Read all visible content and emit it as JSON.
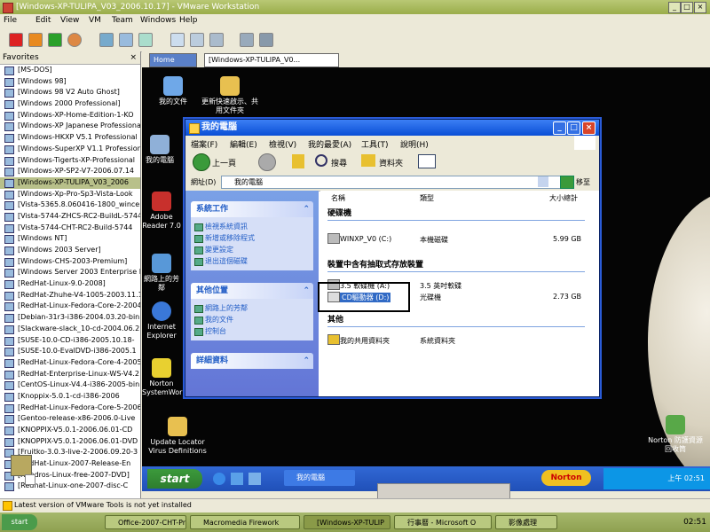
{
  "host": {
    "title": "[Windows-XP-TULIPA_V03_2006.10.17] - VMware Workstation",
    "menu": [
      "File",
      "Edit",
      "View",
      "VM",
      "Team",
      "Windows",
      "Help"
    ],
    "favorites_title": "Favorites",
    "favorites": [
      "[MS-DOS]",
      "[Windows 98]",
      "[Windows 98 V2 Auto Ghost]",
      "[Windows 2000 Professional]",
      "[Windows-XP-Home-Edition-1-KO",
      "[Windows-XP Japanese Professional",
      "[Windows-HKXP V5.1 Professional",
      "[Windows-SuperXP V1.1 Professional",
      "[Windows-Tigerts-XP-Professional",
      "[Windows-XP-SP2-V7-2006.07.14",
      "[Windows-XP-TULIPA_V03_2006",
      "[Windows-Xp-Pro-Sp3-Vista-Look",
      "[Vista-5365.8.060416-1800_wincent",
      "[Vista-5744-ZHCS-RC2-BuildL-5744",
      "[Vista-5744-CHT-RC2-Build-5744",
      "[Windows NT]",
      "[Windows 2003 Server]",
      "[Windows-CHS-2003-Premium]",
      "[Windows Server 2003 Enterprise E",
      "[RedHat-Linux-9.0-2008]",
      "[RedHat-Zhuhe-V4-1005-2003.11.15",
      "[RedHat-Linux-Fedora-Core-2-2004",
      "[Debian-31r3-i386-2004.03.20-bin",
      "[Slackware-slack_10-cd-2004.06.2",
      "[SUSE-10.0-CD-i386-2005.10.18-",
      "[SUSE-10.0-EvalDVD-i386-2005.1",
      "[RedHat-Linux-Fedora-Core-4-2005",
      "[RedHat-Enterprise-Linux-WS-V4.2",
      "[CentOS-Linux-V4.4-i386-2005-bin",
      "[Knoppix-5.0.1-cd-i386-2006",
      "[RedHat-Linux-Fedora-Core-5-2006",
      "[Gentoo-release-x86-2006.0-Live",
      "[KNOPPIX-V5.0.1-2006.06.01-CD",
      "[KNOPPIX-V5.0.1-2006.06.01-DVD",
      "[Fruitko-3.0.3-live-2-2006.09.20-3",
      "[RedHat-Linux-2007-Release-En",
      "[Xandros-Linux-free-2007-DVD]",
      "[Redhat-Linux-one-2007-disc-C"
    ],
    "selected_favorite_index": 10,
    "status": "Latest version of VMware Tools is not yet installed",
    "taskbar": {
      "start": "start",
      "buttons": [
        "Office-2007-CHT-Pro",
        "Macromedia Firework",
        "[Windows-XP-TULIP",
        "行事曆 - Microsoft O",
        "影像處理"
      ],
      "clock": "02:51"
    }
  },
  "guest": {
    "tabs": [
      "Home",
      "[Windows-XP-TULIPA_V0..."
    ],
    "desktop_icons": [
      {
        "label": "我的文件",
        "color": "#6fa8e8"
      },
      {
        "label": "更新快速啟示、共用文件夾",
        "color": "#e8c050"
      },
      {
        "label": "我的電腦",
        "color": "#8fb0d8"
      },
      {
        "label": "Adobe Reader 7.0",
        "color": "#c8302c"
      },
      {
        "label": "網路上的芳鄰",
        "color": "#5898d8"
      },
      {
        "label": "Internet Explorer",
        "color": "#3a78d8"
      },
      {
        "label": "Norton SystemWorks",
        "color": "#e8d030"
      },
      {
        "label": "Update Locator Virus Definitions",
        "color": "#e8c050"
      },
      {
        "label": "Norton 防護資源回收筒",
        "color": "#58a848"
      }
    ],
    "taskbar": {
      "start": "start",
      "window_button": "我的電腦",
      "norton": "Norton",
      "clock": "上午 02:51"
    }
  },
  "explorer": {
    "title": "我的電腦",
    "menu": [
      "檔案(F)",
      "編輯(E)",
      "檢視(V)",
      "我的最愛(A)",
      "工具(T)",
      "說明(H)"
    ],
    "toolbar": {
      "back": "上一頁",
      "search": "搜尋",
      "folders": "資料夾"
    },
    "address_label": "網址(D)",
    "address_value": "我的電腦",
    "go_label": "移至",
    "left_pane": [
      {
        "heading": "系統工作",
        "items": [
          "檢視系統資訊",
          "新增或移除程式",
          "變更設定",
          "退出這個磁碟"
        ]
      },
      {
        "heading": "其他位置",
        "items": [
          "網路上的芳鄰",
          "我的文件",
          "控制台"
        ]
      },
      {
        "heading": "詳細資料",
        "items": []
      }
    ],
    "columns": [
      "名稱",
      "類型",
      "大小總計"
    ],
    "sections": [
      {
        "title": "硬碟機",
        "rows": [
          {
            "name": "WINXP_V0 (C:)",
            "type": "本機磁碟",
            "size": "5.99 GB"
          }
        ]
      },
      {
        "title": "裝置中含有抽取式存放裝置",
        "rows": [
          {
            "name": "3.5 軟碟機 (A:)",
            "type": "3.5 英吋軟碟",
            "size": ""
          },
          {
            "name": "CD驅動器 (D:)",
            "type": "光碟機",
            "size": "2.73 GB"
          }
        ]
      },
      {
        "title": "其他",
        "rows": [
          {
            "name": "我的共用資料夾",
            "type": "系統資料夾",
            "size": ""
          }
        ]
      }
    ]
  }
}
